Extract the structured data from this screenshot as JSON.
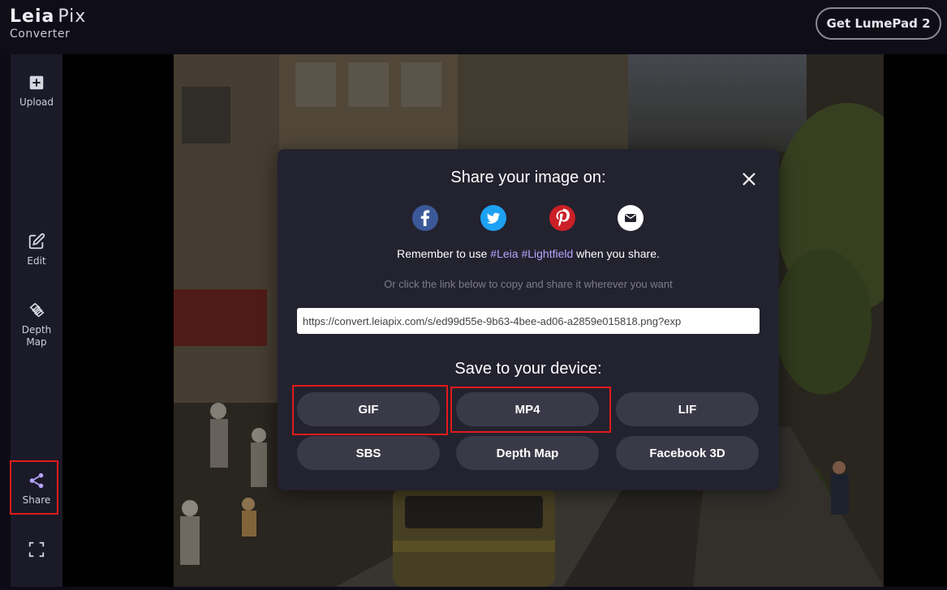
{
  "header": {
    "logo_main": "Leia",
    "logo_pix": "Pix",
    "logo_sub": "Converter",
    "cta_label": "Get LumePad 2"
  },
  "sidebar": {
    "items": [
      {
        "label": "Upload",
        "icon": "plus-square-icon"
      },
      {
        "label": "Edit",
        "icon": "edit-icon"
      },
      {
        "label": "Depth\nMap",
        "icon": "layers-icon"
      },
      {
        "label": "Share",
        "icon": "share-icon"
      },
      {
        "label": "",
        "icon": "fullscreen-icon"
      }
    ]
  },
  "modal": {
    "title": "Share your image on:",
    "close_icon": "close-icon",
    "social": [
      {
        "name": "facebook",
        "icon": "facebook-icon",
        "color": "#3b5998"
      },
      {
        "name": "twitter",
        "icon": "twitter-icon",
        "color": "#1da1f2"
      },
      {
        "name": "pinterest",
        "icon": "pinterest-icon",
        "color": "#cb2027"
      },
      {
        "name": "email",
        "icon": "email-icon",
        "color": "#ffffff"
      }
    ],
    "reminder_prefix": "Remember to use ",
    "reminder_tag1": "#Leia",
    "reminder_tag2": "#Lightfield",
    "reminder_suffix": " when you share.",
    "hint": "Or click the link below to copy and share it wherever you want",
    "link_value": "https://convert.leiapix.com/s/ed99d55e-9b63-4bee-ad06-a2859e015818.png?exp",
    "save_title": "Save to your device:",
    "download_buttons": [
      "GIF",
      "MP4",
      "LIF",
      "SBS",
      "Depth Map",
      "Facebook 3D"
    ]
  },
  "colors": {
    "accent_tag": "#b9a4ff",
    "highlight_box": "#e11b1b",
    "button_bg": "#3a3947",
    "modal_bg": "#23222f"
  }
}
